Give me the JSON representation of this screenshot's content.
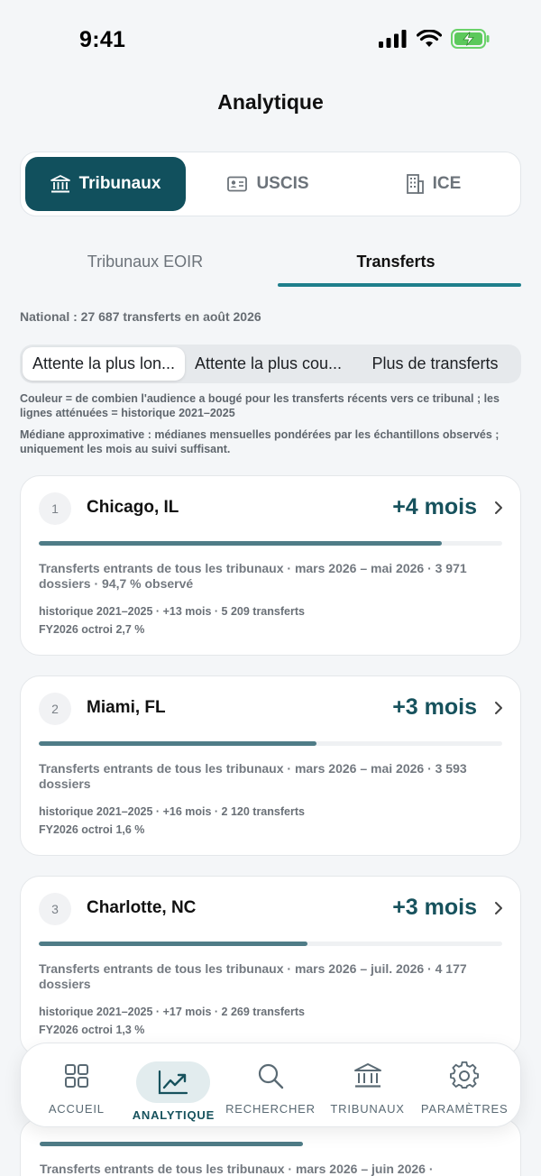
{
  "status_bar": {
    "time": "9:41"
  },
  "page_title": "Analytique",
  "main_segments": [
    {
      "label": "Tribunaux",
      "icon": "courthouse-icon",
      "active": true
    },
    {
      "label": "USCIS",
      "icon": "id-card-icon",
      "active": false
    },
    {
      "label": "ICE",
      "icon": "building-icon",
      "active": false
    }
  ],
  "sub_tabs": [
    {
      "label": "Tribunaux EOIR",
      "active": false
    },
    {
      "label": "Transferts",
      "active": true
    }
  ],
  "national_summary": "National : 27 687 transferts en août 2026",
  "sort_options": [
    {
      "label": "Attente la plus lon...",
      "active": true
    },
    {
      "label": "Attente la plus cou...",
      "active": false
    },
    {
      "label": "Plus de transferts",
      "active": false
    }
  ],
  "legend_color": "Couleur = de combien l'audience a bougé pour les transferts récents vers ce tribunal ; les lignes atténuées = historique 2021–2025",
  "legend_median": "Médiane approximative : médianes mensuelles pondérées par les échantillons observés ; uniquement les mois au suivi suffisant.",
  "cards": [
    {
      "rank": "1",
      "city": "Chicago, IL",
      "delta": "+4 mois",
      "bar_fraction": 0.87,
      "description": "Transferts entrants de tous les tribunaux · mars 2026 – mai 2026 · 3 971 dossiers · 94,7 % observé",
      "history": "historique 2021–2025 · +13 mois · 5 209 transferts",
      "fy": "FY2026 octroi 2,7 %"
    },
    {
      "rank": "2",
      "city": "Miami, FL",
      "delta": "+3 mois",
      "bar_fraction": 0.6,
      "description": "Transferts entrants de tous les tribunaux · mars 2026 – mai 2026 · 3 593 dossiers",
      "history": "historique 2021–2025 · +16 mois · 2 120 transferts",
      "fy": "FY2026 octroi 1,6 %"
    },
    {
      "rank": "3",
      "city": "Charlotte, NC",
      "delta": "+3 mois",
      "bar_fraction": 0.58,
      "description": "Transferts entrants de tous les tribunaux · mars 2026 – juil. 2026 · 4 177 dossiers",
      "history": "historique 2021–2025 · +17 mois · 2 269 transferts",
      "fy": "FY2026 octroi 1,3 %"
    }
  ],
  "card4": {
    "bar_fraction": 0.57,
    "description": "Transferts entrants de tous les tribunaux · mars 2026 – juin 2026 ·"
  },
  "bottom_nav": [
    {
      "label": "ACCUEIL",
      "icon": "grid-icon",
      "active": false
    },
    {
      "label": "ANALYTIQUE",
      "icon": "trend-chart-icon",
      "active": true
    },
    {
      "label": "RECHERCHER",
      "icon": "search-icon",
      "active": false
    },
    {
      "label": "TRIBUNAUX",
      "icon": "courthouse-icon",
      "active": false
    },
    {
      "label": "PARAMÈTRES",
      "icon": "gear-icon",
      "active": false
    }
  ],
  "colors": {
    "accent": "#11505d",
    "underline": "#1f7f8c",
    "bar": "#4f7c87",
    "delta": "#17525d"
  }
}
